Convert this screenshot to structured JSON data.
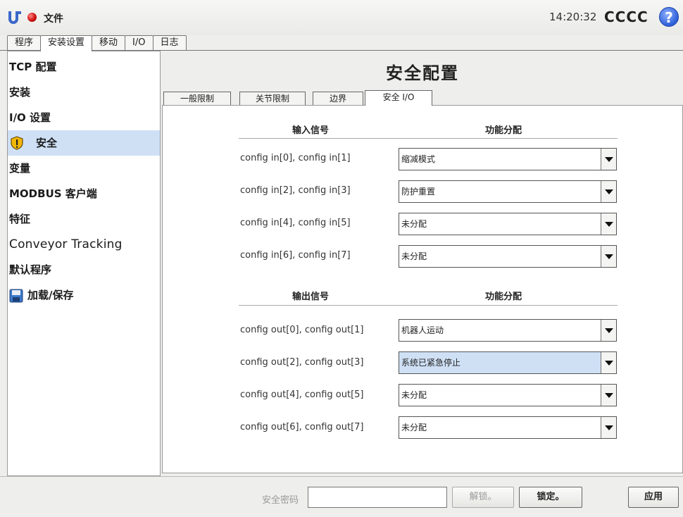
{
  "topbar": {
    "file_menu": "文件",
    "time": "14:20:32",
    "robot_name": "CCCC",
    "help": "?"
  },
  "main_tabs": [
    "程序",
    "安装设置",
    "移动",
    "I/O",
    "日志"
  ],
  "sidebar": {
    "items": [
      {
        "label": "TCP 配置"
      },
      {
        "label": "安装"
      },
      {
        "label": "I/O 设置"
      },
      {
        "label": "安全"
      },
      {
        "label": "变量"
      },
      {
        "label": "MODBUS 客户端"
      },
      {
        "label": "特征"
      },
      {
        "label": "Conveyor Tracking"
      },
      {
        "label": "默认程序"
      },
      {
        "label": "加载/保存"
      }
    ]
  },
  "content": {
    "title": "安全配置",
    "sub_tabs": [
      "一般限制",
      "关节限制",
      "边界",
      "安全 I/O"
    ],
    "inputs": {
      "header_signal": "输入信号",
      "header_function": "功能分配",
      "rows": [
        {
          "signal": "config in[0], config in[1]",
          "value": "缩减模式"
        },
        {
          "signal": "config in[2], config in[3]",
          "value": "防护重置"
        },
        {
          "signal": "config in[4], config in[5]",
          "value": "未分配"
        },
        {
          "signal": "config in[6], config in[7]",
          "value": "未分配"
        }
      ]
    },
    "outputs": {
      "header_signal": "输出信号",
      "header_function": "功能分配",
      "rows": [
        {
          "signal": "config out[0], config out[1]",
          "value": "机器人运动"
        },
        {
          "signal": "config out[2], config out[3]",
          "value": "系统已紧急停止"
        },
        {
          "signal": "config out[4], config out[5]",
          "value": "未分配"
        },
        {
          "signal": "config out[6], config out[7]",
          "value": "未分配"
        }
      ]
    }
  },
  "bottom": {
    "password_label": "安全密码",
    "password_value": "",
    "unlock_label": "解锁。",
    "lock_label": "锁定。",
    "apply_label": "应用"
  },
  "colors": {
    "selected_bg": "#cfe0f5",
    "alert_red": "#d01010",
    "help_blue": "#2d5fd8"
  }
}
